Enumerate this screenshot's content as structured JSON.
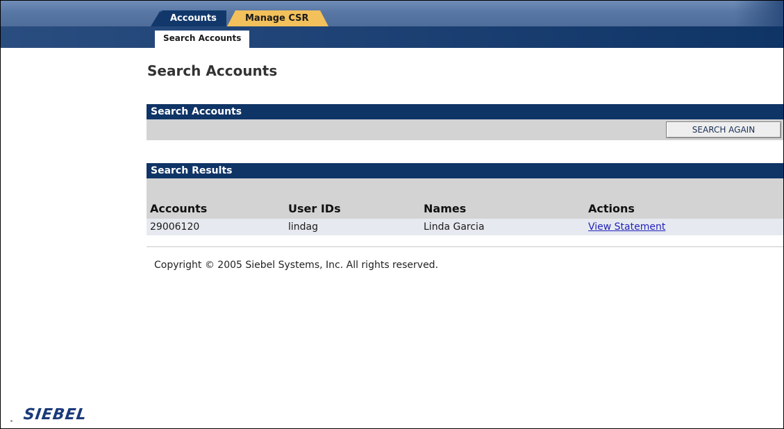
{
  "nav": {
    "tabs": [
      {
        "label": "Accounts"
      },
      {
        "label": "Manage CSR"
      }
    ],
    "subtabs": [
      {
        "label": "Search Accounts"
      }
    ]
  },
  "page": {
    "title": "Search Accounts"
  },
  "search_panel": {
    "header": "Search Accounts",
    "button_label": "SEARCH AGAIN"
  },
  "results": {
    "header": "Search Results",
    "columns": [
      "Accounts",
      "User IDs",
      "Names",
      "Actions"
    ],
    "rows": [
      {
        "account": "29006120",
        "user_id": "lindag",
        "name": "Linda Garcia",
        "action": "View Statement"
      }
    ]
  },
  "footer": {
    "copyright": "Copyright © 2005 Siebel Systems, Inc. All rights reserved.",
    "logo": "SIEBEL"
  },
  "colors": {
    "nav_dark": "#0f3466",
    "active_tab": "#f3c15b",
    "panel_gray": "#d3d3d3",
    "link": "#2222bb"
  }
}
